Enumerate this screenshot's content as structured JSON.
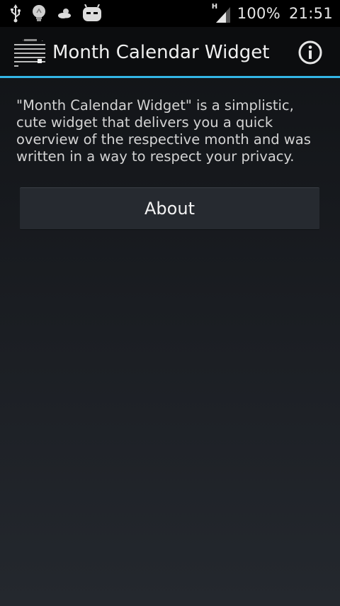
{
  "status_bar": {
    "icons": [
      "usb-icon",
      "lightbulb-icon",
      "weather-icon",
      "cyanogenmod-mascot-icon"
    ],
    "network_type": "H",
    "battery": "100%",
    "time": "21:51"
  },
  "action_bar": {
    "title": "Month Calendar Widget",
    "accent_color": "#33b5e5",
    "info_icon": "info-icon"
  },
  "main": {
    "description": "\"Month Calendar Widget\" is a simplistic, cute widget that delivers you a quick overview of the respective month and was written in a way to respect your privacy.",
    "about_button_label": "About"
  }
}
